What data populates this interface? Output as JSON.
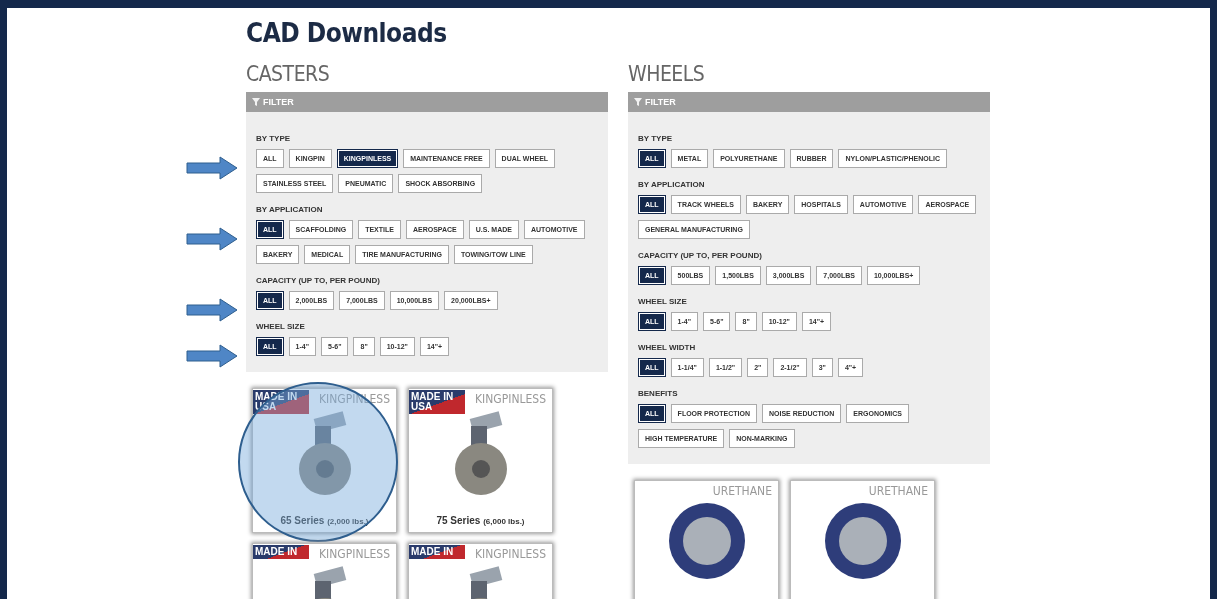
{
  "page": {
    "title": "CAD Downloads"
  },
  "sections": [
    {
      "heading": "CASTERS",
      "filter": {
        "title": "FILTER",
        "groups": [
          {
            "label": "BY TYPE",
            "highlighted": true,
            "options": [
              {
                "label": "ALL",
                "selected": false
              },
              {
                "label": "KINGPIN",
                "selected": false
              },
              {
                "label": "KINGPINLESS",
                "selected": true
              },
              {
                "label": "MAINTENANCE FREE",
                "selected": false
              },
              {
                "label": "DUAL WHEEL",
                "selected": false
              },
              {
                "label": "STAINLESS STEEL",
                "selected": false
              },
              {
                "label": "PNEUMATIC",
                "selected": false
              },
              {
                "label": "SHOCK ABSORBING",
                "selected": false
              }
            ]
          },
          {
            "label": "BY APPLICATION",
            "highlighted": true,
            "options": [
              {
                "label": "ALL",
                "selected": true
              },
              {
                "label": "SCAFFOLDING",
                "selected": false
              },
              {
                "label": "TEXTILE",
                "selected": false
              },
              {
                "label": "AEROSPACE",
                "selected": false
              },
              {
                "label": "U.S. MADE",
                "selected": false
              },
              {
                "label": "AUTOMOTIVE",
                "selected": false
              },
              {
                "label": "BAKERY",
                "selected": false
              },
              {
                "label": "MEDICAL",
                "selected": false
              },
              {
                "label": "TIRE MANUFACTURING",
                "selected": false
              },
              {
                "label": "TOWING/TOW LINE",
                "selected": false
              }
            ]
          },
          {
            "label": "CAPACITY (UP TO, PER POUND)",
            "highlighted": true,
            "options": [
              {
                "label": "ALL",
                "selected": true
              },
              {
                "label": "2,000LBS",
                "selected": false
              },
              {
                "label": "7,000LBS",
                "selected": false
              },
              {
                "label": "10,000LBS",
                "selected": false
              },
              {
                "label": "20,000LBS+",
                "selected": false
              }
            ]
          },
          {
            "label": "WHEEL SIZE",
            "highlighted": true,
            "options": [
              {
                "label": "ALL",
                "selected": true
              },
              {
                "label": "1-4\"",
                "selected": false
              },
              {
                "label": "5-6\"",
                "selected": false
              },
              {
                "label": "8\"",
                "selected": false
              },
              {
                "label": "10-12\"",
                "selected": false
              },
              {
                "label": "14\"+",
                "selected": false
              }
            ]
          }
        ]
      },
      "products": [
        {
          "kind": "caster",
          "badge": "MADE IN USA",
          "category": "KINGPINLESS",
          "name": "65 Series",
          "capacity": "(2,000 lbs.)",
          "highlighted": true
        },
        {
          "kind": "caster",
          "badge": "MADE IN USA",
          "category": "KINGPINLESS",
          "name": "75 Series",
          "capacity": "(6,000 lbs.)",
          "highlighted": false
        },
        {
          "kind": "caster",
          "badge": "MADE IN",
          "category": "KINGPINLESS",
          "highlighted": false
        },
        {
          "kind": "caster",
          "badge": "MADE IN",
          "category": "KINGPINLESS",
          "highlighted": false
        }
      ]
    },
    {
      "heading": "WHEELS",
      "filter": {
        "title": "FILTER",
        "groups": [
          {
            "label": "BY TYPE",
            "highlighted": false,
            "options": [
              {
                "label": "ALL",
                "selected": true
              },
              {
                "label": "METAL",
                "selected": false
              },
              {
                "label": "POLYURETHANE",
                "selected": false
              },
              {
                "label": "RUBBER",
                "selected": false
              },
              {
                "label": "NYLON/PLASTIC/PHENOLIC",
                "selected": false
              }
            ]
          },
          {
            "label": "BY APPLICATION",
            "highlighted": false,
            "options": [
              {
                "label": "ALL",
                "selected": true
              },
              {
                "label": "TRACK WHEELS",
                "selected": false
              },
              {
                "label": "BAKERY",
                "selected": false
              },
              {
                "label": "HOSPITALS",
                "selected": false
              },
              {
                "label": "AUTOMOTIVE",
                "selected": false
              },
              {
                "label": "AEROSPACE",
                "selected": false
              },
              {
                "label": "GENERAL MANUFACTURING",
                "selected": false
              }
            ]
          },
          {
            "label": "CAPACITY (UP TO, PER POUND)",
            "highlighted": false,
            "options": [
              {
                "label": "ALL",
                "selected": true
              },
              {
                "label": "500LBS",
                "selected": false
              },
              {
                "label": "1,500LBS",
                "selected": false
              },
              {
                "label": "3,000LBS",
                "selected": false
              },
              {
                "label": "7,000LBS",
                "selected": false
              },
              {
                "label": "10,000LBS+",
                "selected": false
              }
            ]
          },
          {
            "label": "WHEEL SIZE",
            "highlighted": false,
            "options": [
              {
                "label": "ALL",
                "selected": true
              },
              {
                "label": "1-4\"",
                "selected": false
              },
              {
                "label": "5-6\"",
                "selected": false
              },
              {
                "label": "8\"",
                "selected": false
              },
              {
                "label": "10-12\"",
                "selected": false
              },
              {
                "label": "14\"+",
                "selected": false
              }
            ]
          },
          {
            "label": "WHEEL WIDTH",
            "highlighted": false,
            "options": [
              {
                "label": "ALL",
                "selected": true
              },
              {
                "label": "1-1/4\"",
                "selected": false
              },
              {
                "label": "1-1/2\"",
                "selected": false
              },
              {
                "label": "2\"",
                "selected": false
              },
              {
                "label": "2-1/2\"",
                "selected": false
              },
              {
                "label": "3\"",
                "selected": false
              },
              {
                "label": "4\"+",
                "selected": false
              }
            ]
          },
          {
            "label": "BENEFITS",
            "highlighted": false,
            "options": [
              {
                "label": "ALL",
                "selected": true
              },
              {
                "label": "FLOOR PROTECTION",
                "selected": false
              },
              {
                "label": "NOISE REDUCTION",
                "selected": false
              },
              {
                "label": "ERGONOMICS",
                "selected": false
              },
              {
                "label": "HIGH TEMPERATURE",
                "selected": false
              },
              {
                "label": "NON-MARKING",
                "selected": false
              }
            ]
          }
        ]
      },
      "products": [
        {
          "kind": "wheel",
          "category": "URETHANE",
          "highlighted": false
        },
        {
          "kind": "wheel",
          "category": "URETHANE",
          "highlighted": false
        }
      ]
    }
  ]
}
